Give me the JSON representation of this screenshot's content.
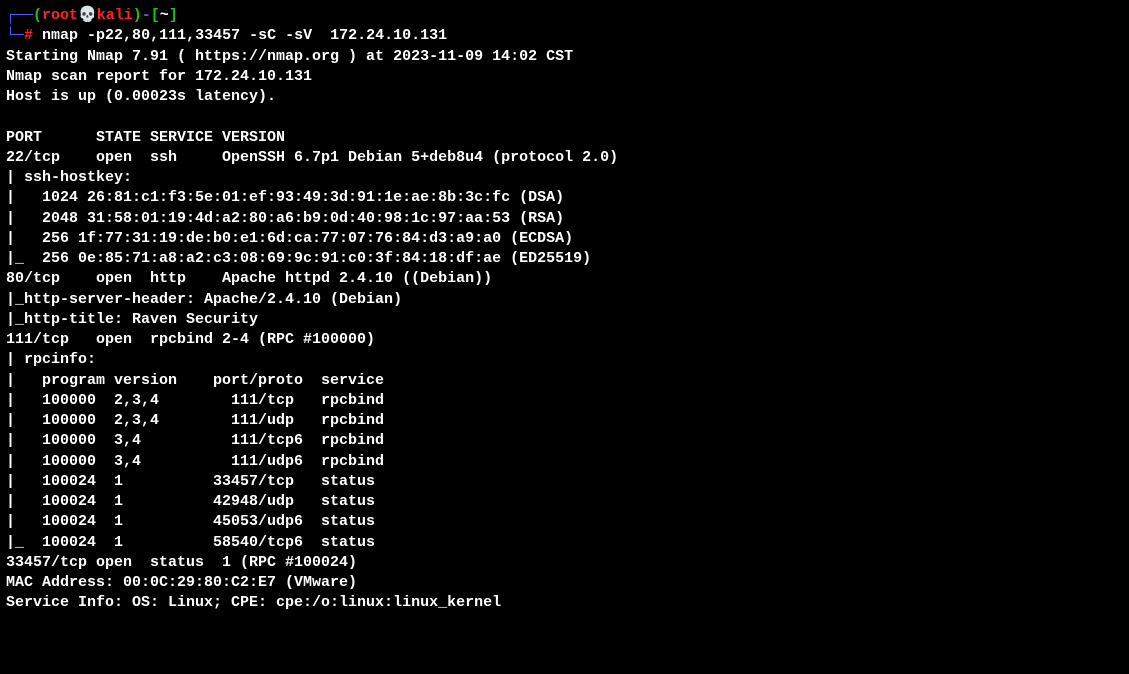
{
  "prompt": {
    "user": "root",
    "host": "kali",
    "cwd": "~",
    "symbol": "#"
  },
  "command": "nmap -p22,80,111,33457 -sC -sV  172.24.10.131",
  "output": {
    "line1": "Starting Nmap 7.91 ( https://nmap.org ) at 2023-11-09 14:02 CST",
    "line2": "Nmap scan report for 172.24.10.131",
    "line3": "Host is up (0.00023s latency).",
    "blank1": "",
    "header": "PORT      STATE SERVICE VERSION",
    "p22": "22/tcp    open  ssh     OpenSSH 6.7p1 Debian 5+deb8u4 (protocol 2.0)",
    "ssh_hostkey": "| ssh-hostkey: ",
    "ssh_dsa": "|   1024 26:81:c1:f3:5e:01:ef:93:49:3d:91:1e:ae:8b:3c:fc (DSA)",
    "ssh_rsa": "|   2048 31:58:01:19:4d:a2:80:a6:b9:0d:40:98:1c:97:aa:53 (RSA)",
    "ssh_ecdsa": "|   256 1f:77:31:19:de:b0:e1:6d:ca:77:07:76:84:d3:a9:a0 (ECDSA)",
    "ssh_ed25519": "|_  256 0e:85:71:a8:a2:c3:08:69:9c:91:c0:3f:84:18:df:ae (ED25519)",
    "p80": "80/tcp    open  http    Apache httpd 2.4.10 ((Debian))",
    "http_server": "|_http-server-header: Apache/2.4.10 (Debian)",
    "http_title": "|_http-title: Raven Security",
    "p111": "111/tcp   open  rpcbind 2-4 (RPC #100000)",
    "rpcinfo": "| rpcinfo: ",
    "rpc_header": "|   program version    port/proto  service",
    "rpc1": "|   100000  2,3,4        111/tcp   rpcbind",
    "rpc2": "|   100000  2,3,4        111/udp   rpcbind",
    "rpc3": "|   100000  3,4          111/tcp6  rpcbind",
    "rpc4": "|   100000  3,4          111/udp6  rpcbind",
    "rpc5": "|   100024  1          33457/tcp   status",
    "rpc6": "|   100024  1          42948/udp   status",
    "rpc7": "|   100024  1          45053/udp6  status",
    "rpc8": "|_  100024  1          58540/tcp6  status",
    "p33457": "33457/tcp open  status  1 (RPC #100024)",
    "mac": "MAC Address: 00:0C:29:80:C2:E7 (VMware)",
    "service_info": "Service Info: OS: Linux; CPE: cpe:/o:linux:linux_kernel"
  }
}
